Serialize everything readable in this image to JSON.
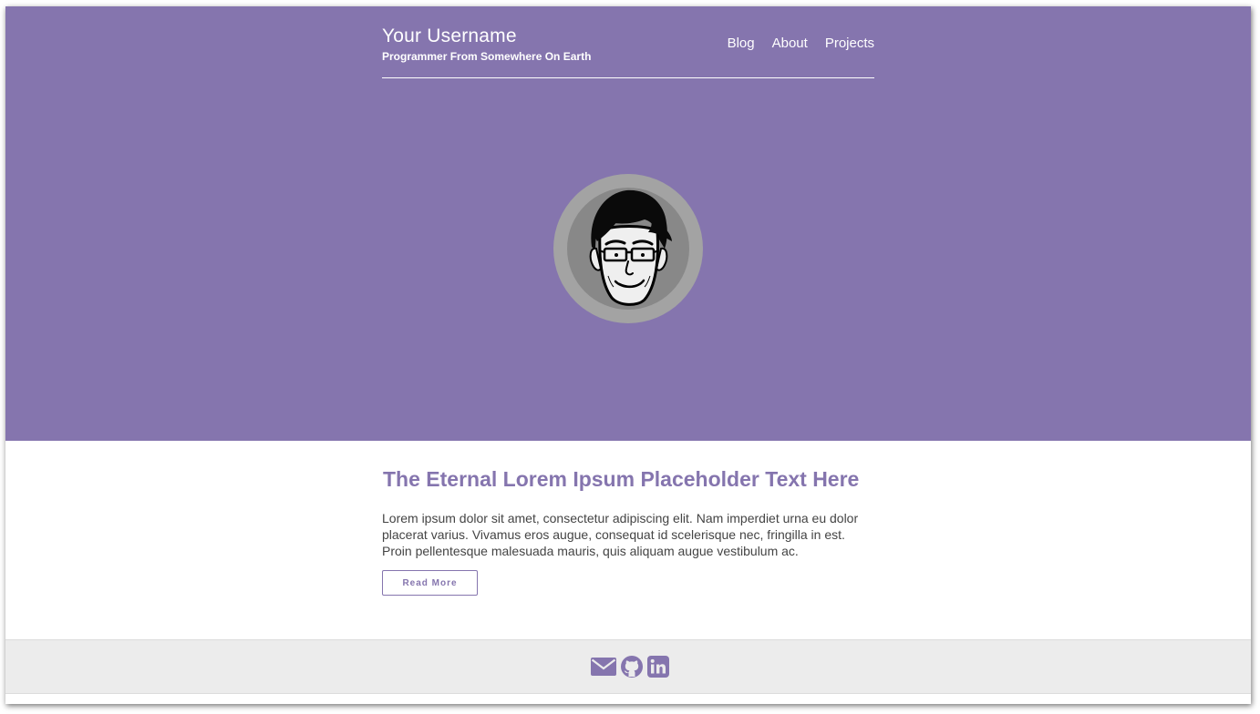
{
  "colors": {
    "accent": "#8575ae",
    "text": "#444444",
    "footer_bg": "#ececec"
  },
  "header": {
    "title": "Your Username",
    "subtitle": "Programmer From Somewhere On Earth"
  },
  "nav": {
    "items": [
      {
        "label": "Blog"
      },
      {
        "label": "About"
      },
      {
        "label": "Projects"
      }
    ]
  },
  "hero": {
    "avatar_icon": "cartoon-face-avatar"
  },
  "post": {
    "title": "The Eternal Lorem Ipsum Placeholder Text Here",
    "excerpt": "Lorem ipsum dolor sit amet, consectetur adipiscing elit. Nam imperdiet urna eu dolor placerat varius. Vivamus eros augue, consequat id scelerisque nec, fringilla in est. Proin pellentesque malesuada mauris, quis aliquam augue vestibulum ac.",
    "read_more_label": "Read More"
  },
  "footer": {
    "social_icons": [
      "envelope-icon",
      "github-icon",
      "linkedin-icon"
    ]
  }
}
